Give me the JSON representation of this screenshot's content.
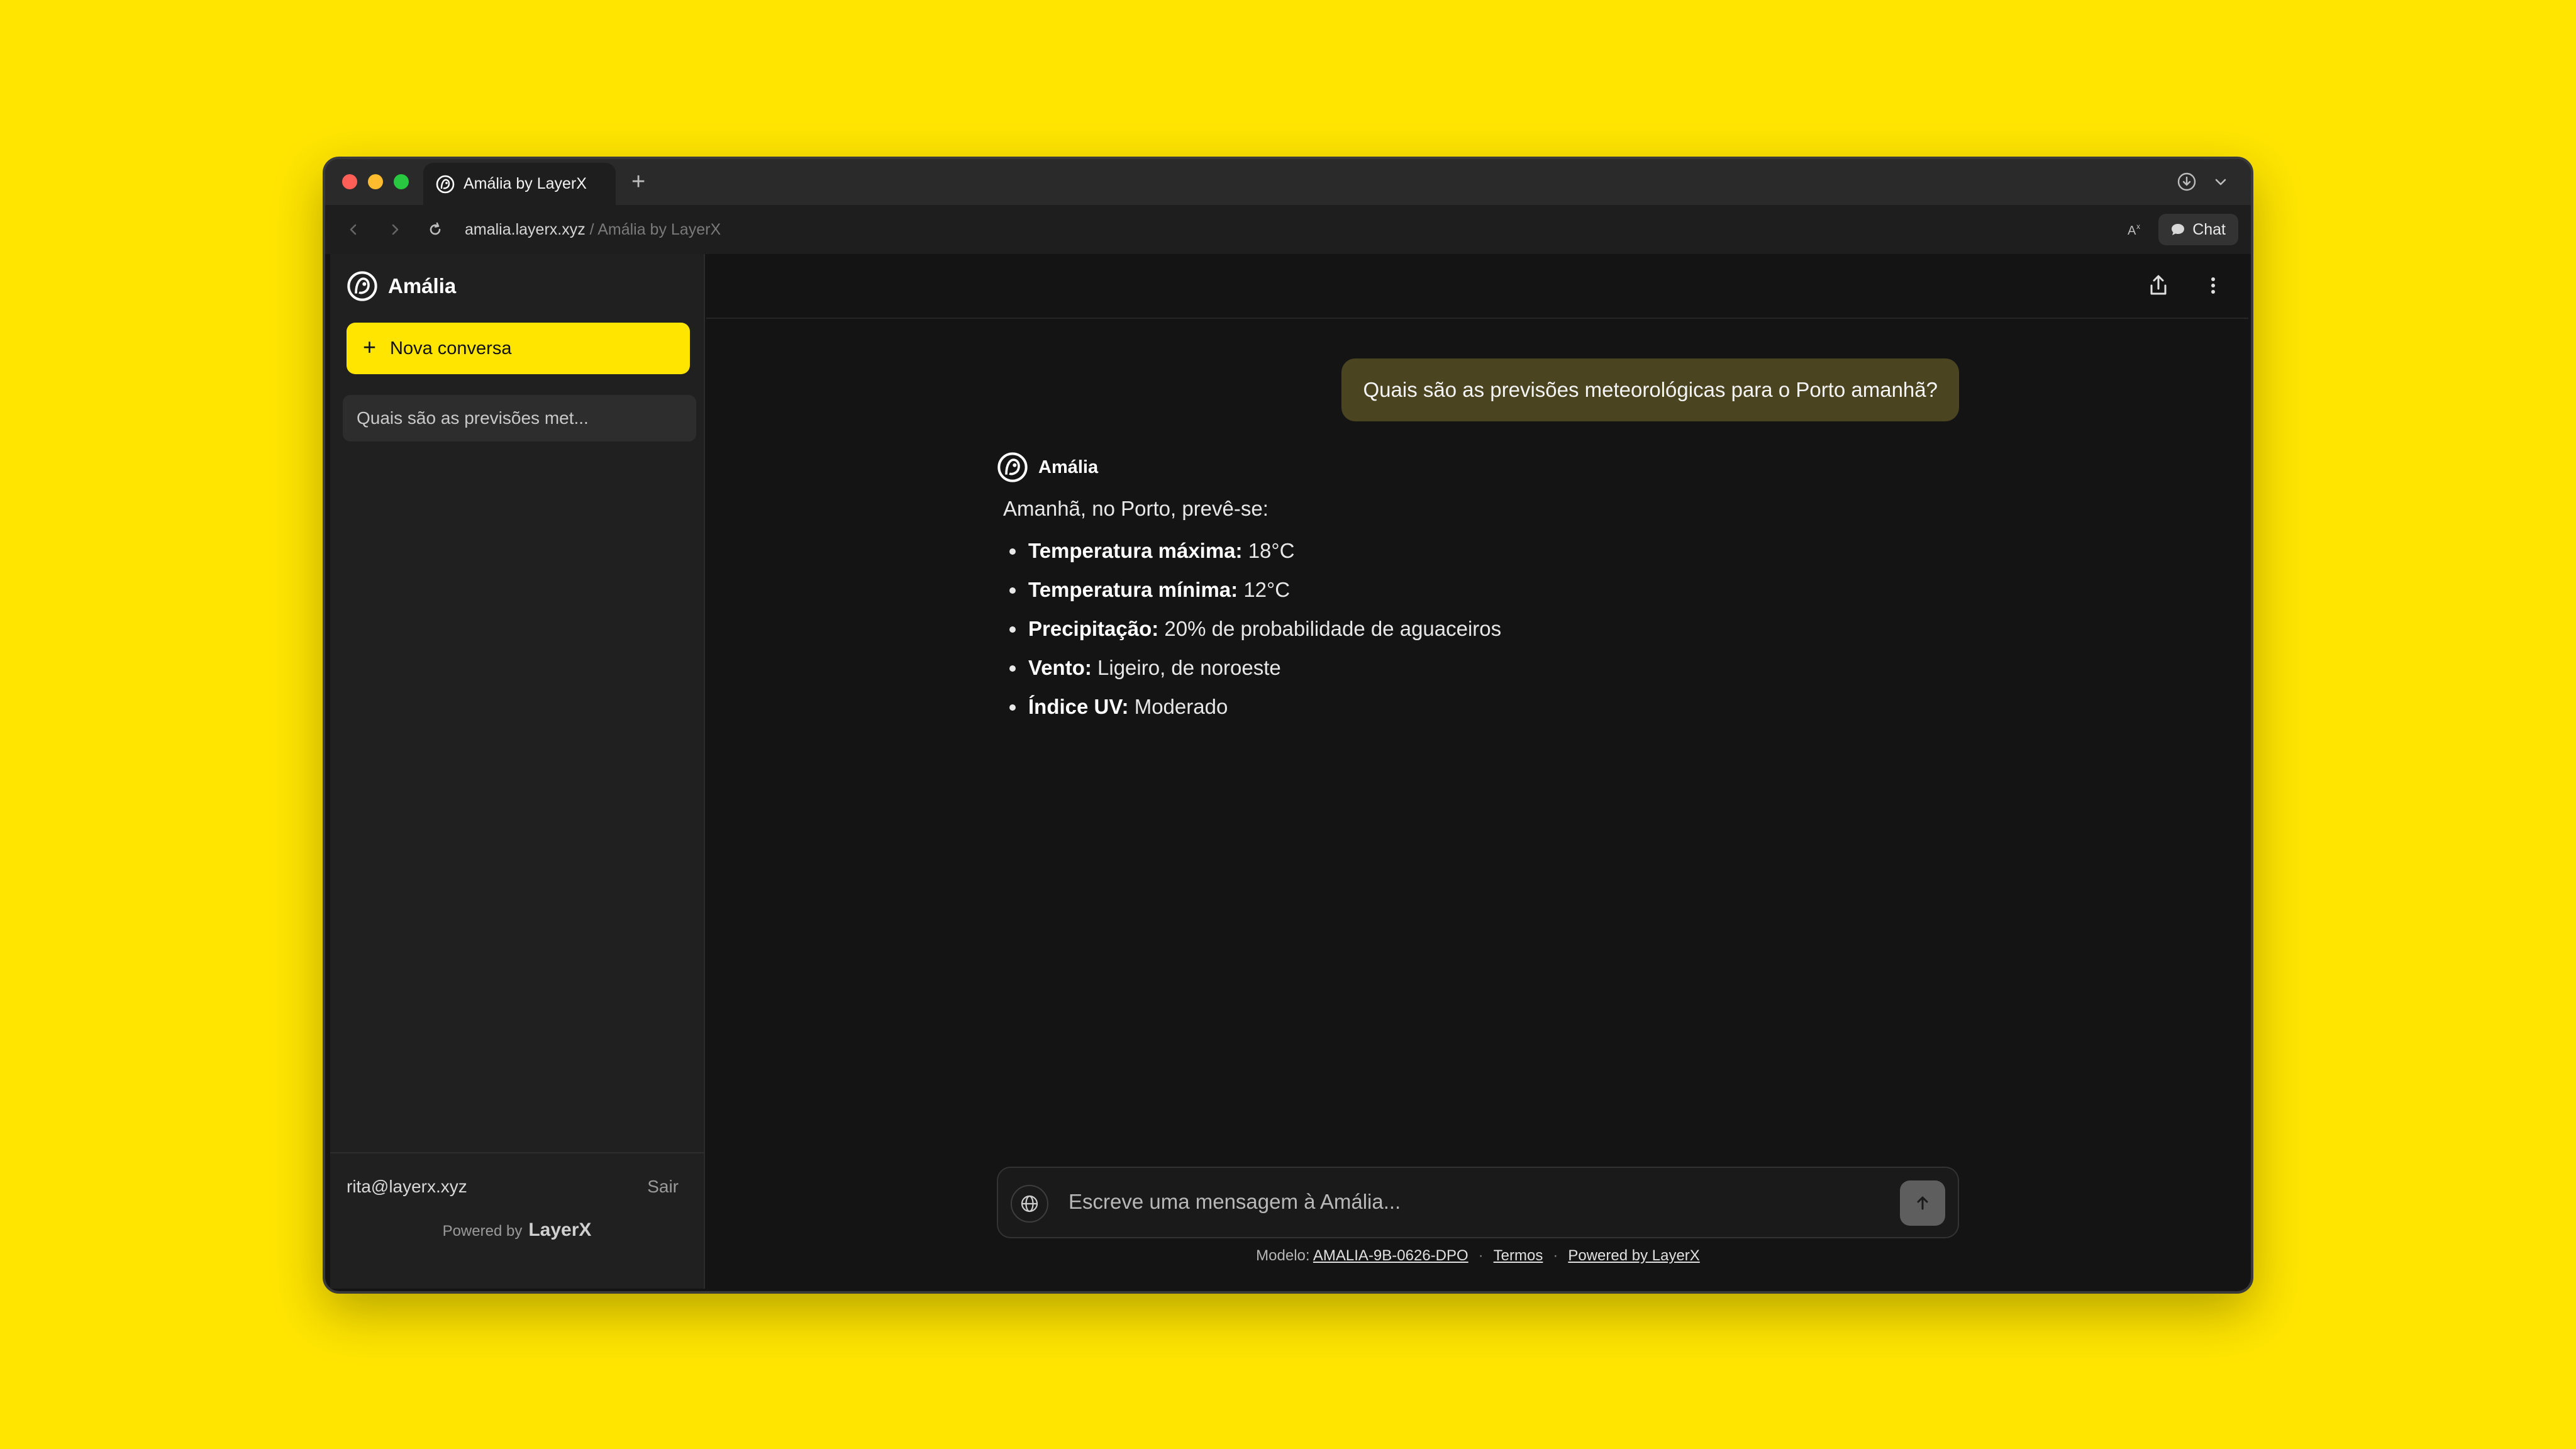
{
  "browser": {
    "tab_title": "Amália by LayerX",
    "new_tab_label": "+",
    "url_host": "amalia.layerx.xyz",
    "url_path": " / Amália by LayerX",
    "translate_label": "A",
    "chat_button_label": "Chat"
  },
  "sidebar": {
    "brand_name": "Amália",
    "new_chat_label": "Nova conversa",
    "history": [
      {
        "label": "Quais são as previsões met..."
      }
    ],
    "user_email": "rita@layerx.xyz",
    "logout_label": "Sair",
    "powered_label": "Powered by",
    "powered_brand": "LayerX"
  },
  "conversation": {
    "user_message": "Quais são as previsões meteorológicas para o Porto amanhã?",
    "assistant_name": "Amália",
    "assistant_intro": "Amanhã, no Porto, prevê-se:",
    "items": [
      {
        "label": "Temperatura máxima:",
        "value": " 18°C"
      },
      {
        "label": "Temperatura mínima:",
        "value": " 12°C"
      },
      {
        "label": "Precipitação:",
        "value": " 20% de probabilidade de aguaceiros"
      },
      {
        "label": "Vento:",
        "value": " Ligeiro, de noroeste"
      },
      {
        "label": "Índice UV:",
        "value": " Moderado"
      }
    ]
  },
  "composer": {
    "placeholder": "Escreve uma mensagem à Amália..."
  },
  "footer": {
    "model_label": "Modelo:",
    "model_value": "AMALIA-9B-0626-DPO",
    "separator": "·",
    "terms_label": "Termos",
    "powered_link": "Powered by LayerX"
  },
  "colors": {
    "background": "#FFE500",
    "accent": "#FFE500",
    "user_bubble": "#4B4420",
    "window": "#141414",
    "sidebar": "#202020"
  },
  "icons": [
    "amalia-logo-icon",
    "download-icon",
    "chevron-down-icon",
    "back-icon",
    "forward-icon",
    "reload-icon",
    "translate-icon",
    "chat-bubble-icon",
    "share-icon",
    "more-vertical-icon",
    "plus-icon",
    "globe-icon",
    "arrow-up-icon"
  ]
}
